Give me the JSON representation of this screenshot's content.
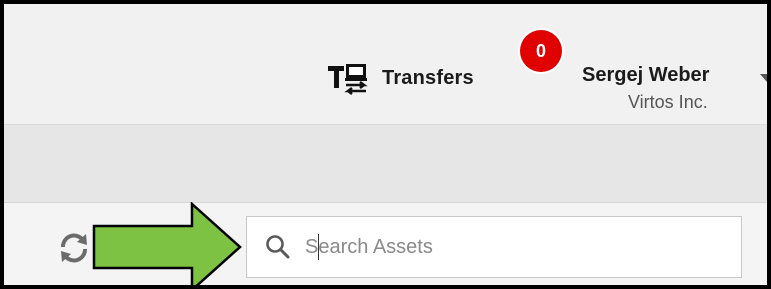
{
  "header": {
    "transfers_label": "Transfers",
    "transfers_icon": "transfers-icon",
    "notification_count": "0",
    "badge_color": "#e00000"
  },
  "user": {
    "name": "Sergej Weber",
    "company": "Virtos Inc.",
    "menu_icon": "chevron-down-icon"
  },
  "toolbar": {
    "refresh_icon": "refresh-icon"
  },
  "search": {
    "placeholder": "Search Assets",
    "value": "",
    "icon": "search-icon"
  },
  "annotation": {
    "arrow_color": "#7dc242",
    "arrow_direction": "right"
  }
}
